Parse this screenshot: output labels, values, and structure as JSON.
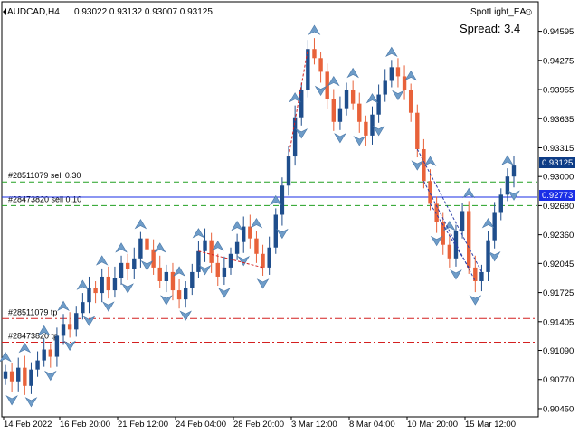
{
  "header": {
    "symbol_timeframe": "AUDCAD,H4",
    "ohlc": "0.93022 0.93132 0.93007 0.93125"
  },
  "expert": {
    "name": "SpotLight_EA",
    "smiley": "☺",
    "spread_label": "Spread: 3.4"
  },
  "price_axis": {
    "ticks": [
      "0.94595",
      "0.94275",
      "0.93955",
      "0.93635",
      "0.93315",
      "0.93000",
      "0.92680",
      "0.92360",
      "0.92045",
      "0.91725",
      "0.91405",
      "0.91090",
      "0.90770",
      "0.90450"
    ],
    "current_price": "0.93125",
    "line_price": "0.92773",
    "current_price_color": "#0d3c86",
    "line_price_color": "#1a2ee6"
  },
  "time_axis": {
    "ticks": [
      "14 Feb 2022",
      "16 Feb 20:00",
      "21 Feb 12:00",
      "24 Feb 04:00",
      "28 Feb 20:00",
      "3 Mar 12:00",
      "8 Mar 04:00",
      "10 Mar 20:00",
      "15 Mar 12:00"
    ]
  },
  "order_lines": [
    {
      "label": "#28511079 sell 0.30",
      "price": 0.9294,
      "style": "green-dash"
    },
    {
      "label": "#28473820 sell 0.10",
      "price": 0.9268,
      "style": "green-dash"
    },
    {
      "label": "",
      "price": 0.92773,
      "style": "blue-solid"
    },
    {
      "label": "#28511079 tp",
      "price": 0.9144,
      "style": "red-dashdot"
    },
    {
      "label": "#28473820 tp",
      "price": 0.9118,
      "style": "red-dashdot"
    }
  ],
  "colors": {
    "bull_candle": "#1f4e8c",
    "bear_candle": "#e8623a",
    "arrow_fill": "#6e9cc8",
    "green_line": "#22a022",
    "red_line": "#d42020",
    "blue_line": "#1a2ee6"
  },
  "chart_data": {
    "type": "candlestick",
    "symbol": "AUDCAD",
    "timeframe": "H4",
    "y_range": [
      0.904,
      0.9472
    ],
    "closes": [
      0.9086,
      0.9075,
      0.909,
      0.907,
      0.9088,
      0.9098,
      0.911,
      0.9102,
      0.9125,
      0.9138,
      0.9132,
      0.915,
      0.9162,
      0.9178,
      0.9172,
      0.919,
      0.9175,
      0.9188,
      0.9205,
      0.9198,
      0.921,
      0.9232,
      0.922,
      0.92,
      0.9185,
      0.9195,
      0.9175,
      0.9165,
      0.9178,
      0.9195,
      0.9218,
      0.923,
      0.9205,
      0.919,
      0.92,
      0.9215,
      0.9228,
      0.9245,
      0.9232,
      0.9215,
      0.92,
      0.9222,
      0.9258,
      0.929,
      0.9322,
      0.9365,
      0.9395,
      0.944,
      0.943,
      0.9415,
      0.9385,
      0.936,
      0.9375,
      0.9395,
      0.938,
      0.936,
      0.9345,
      0.9368,
      0.939,
      0.9405,
      0.942,
      0.941,
      0.9395,
      0.937,
      0.933,
      0.9295,
      0.927,
      0.925,
      0.9225,
      0.921,
      0.924,
      0.9262,
      0.92,
      0.9185,
      0.9195,
      0.923,
      0.926,
      0.928,
      0.93,
      0.9312
    ]
  }
}
